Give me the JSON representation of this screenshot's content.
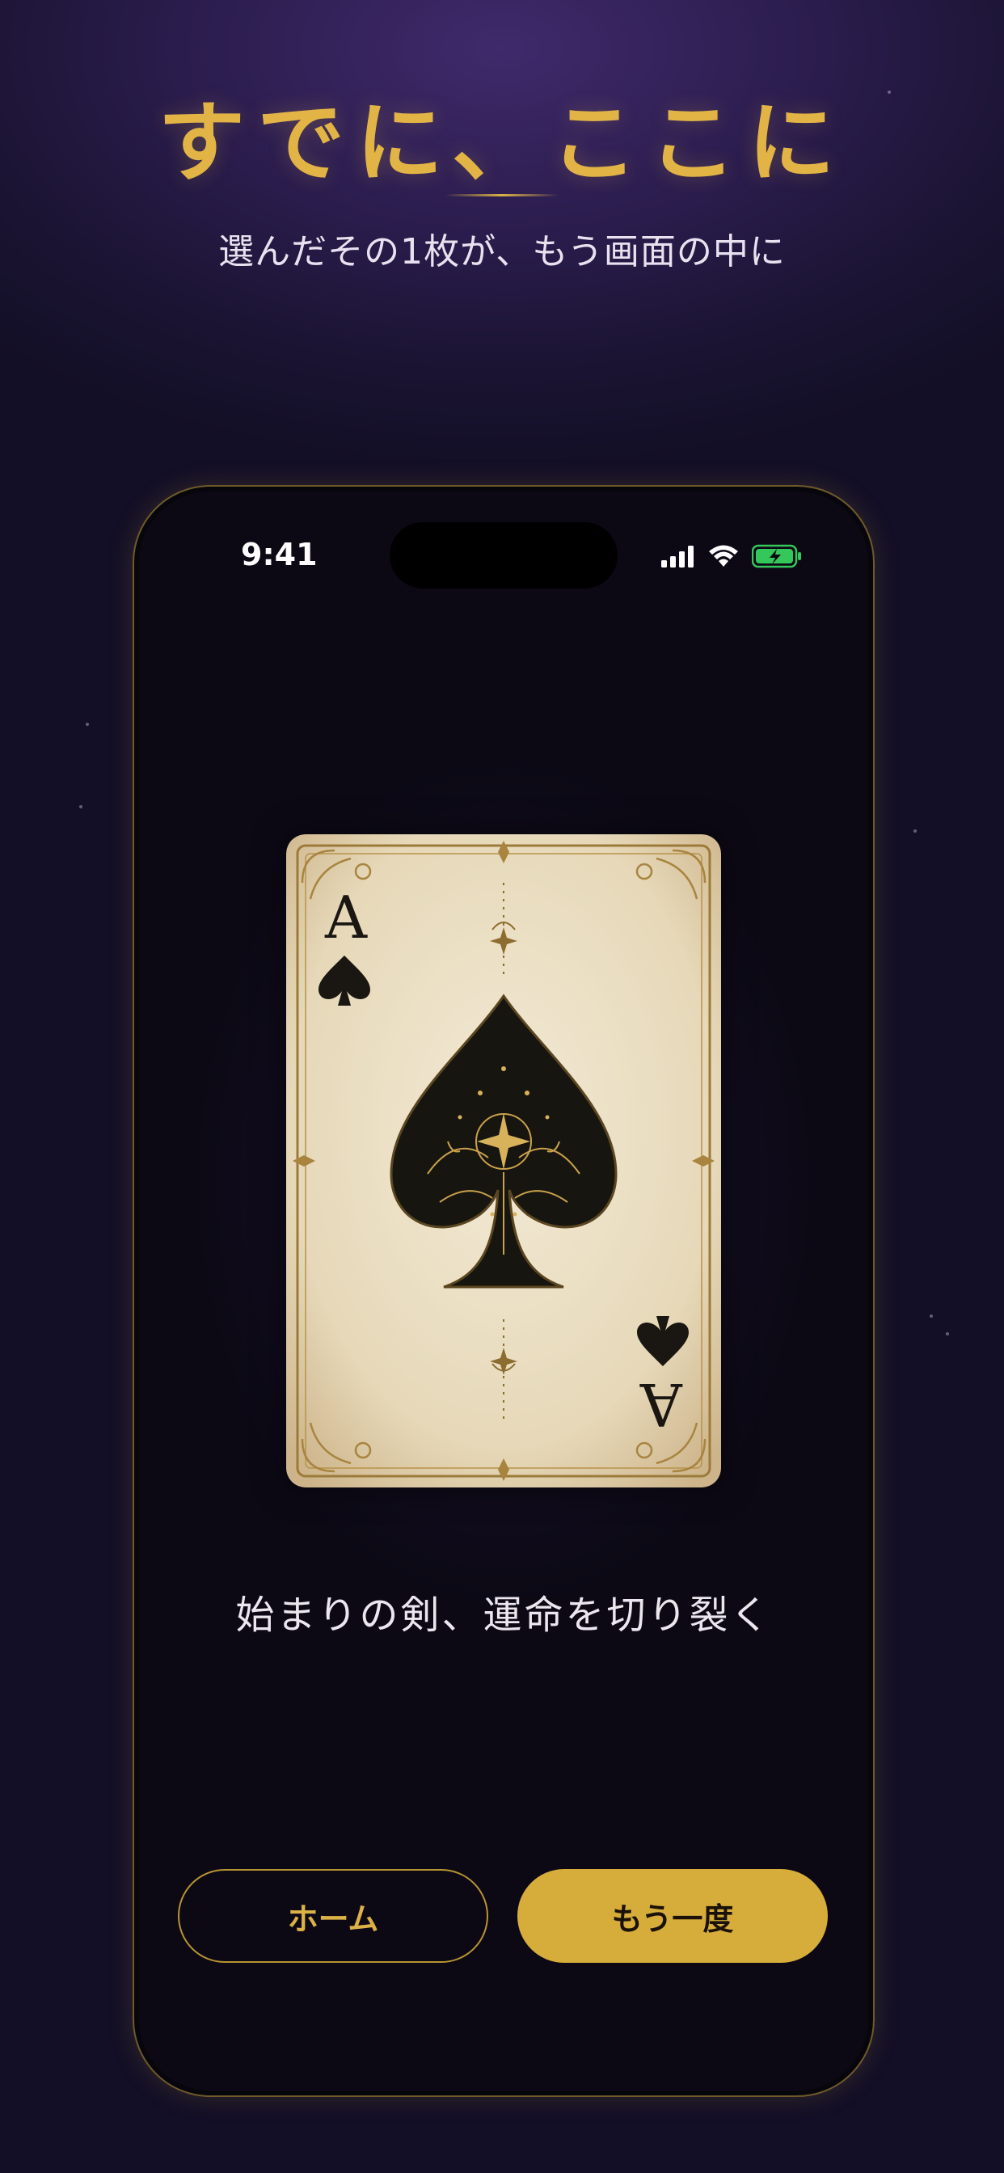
{
  "header": {
    "title": "すでに、ここに",
    "subtitle": "選んだその1枚が、もう画面の中に"
  },
  "status_bar": {
    "time": "9:41",
    "icons": [
      "cellular-signal-icon",
      "wifi-icon",
      "battery-charging-icon"
    ]
  },
  "card": {
    "rank": "A",
    "suit": "spade",
    "caption": "始まりの剣、運命を切り裂く"
  },
  "buttons": {
    "home_label": "ホーム",
    "again_label": "もう一度"
  },
  "colors": {
    "accent_gold": "#dcb246",
    "button_fill": "#d6ad3a",
    "background": "#1b1433",
    "phone_screen": "#0c0915",
    "battery_green": "#34c759"
  }
}
